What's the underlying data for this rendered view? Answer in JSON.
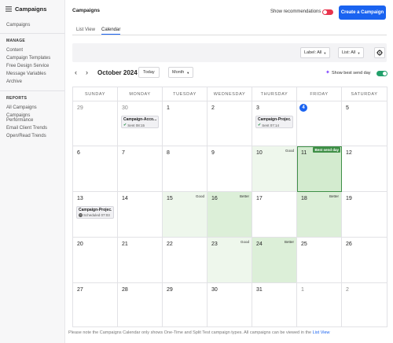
{
  "sidebar": {
    "title": "Campaigns",
    "top_link": "Campaigns",
    "sections": [
      {
        "heading": "MANAGE",
        "items": [
          "Content",
          "Campaign Templates",
          "Free Design Service",
          "Message Variables",
          "Archive"
        ]
      },
      {
        "heading": "REPORTS",
        "items": [
          "All Campaigns",
          "Campaigns Performance",
          "Email Client Trends",
          "Open/Read Trends"
        ]
      }
    ]
  },
  "header": {
    "title": "Campaigns",
    "show_recommendations": "Show recommendations",
    "create_button": "Create a Campaign"
  },
  "tabs": [
    "List View",
    "Calendar"
  ],
  "filters": {
    "label": "Label: All",
    "list": "List: All"
  },
  "nav": {
    "month_title": "October 2024",
    "today": "Today",
    "view": "Month",
    "best_send_day": "Show best send day"
  },
  "weekdays": [
    "SUNDAY",
    "MONDAY",
    "TUESDAY",
    "WEDNESDAY",
    "THURSDAY",
    "FRIDAY",
    "SATURDAY"
  ],
  "weeks": [
    [
      "29",
      "30",
      "1",
      "2",
      "3",
      "4",
      "5"
    ],
    [
      "6",
      "7",
      "8",
      "9",
      "10",
      "11",
      "12"
    ],
    [
      "13",
      "14",
      "15",
      "16",
      "17",
      "18",
      "19"
    ],
    [
      "20",
      "21",
      "22",
      "23",
      "24",
      "25",
      "26"
    ],
    [
      "27",
      "28",
      "29",
      "30",
      "31",
      "1",
      "2"
    ]
  ],
  "tags": {
    "good": "Good",
    "better": "Better",
    "best": "Best send day"
  },
  "events": [
    {
      "title": "Campaign-Acco...",
      "status": "Sent 08:15"
    },
    {
      "title": "Campaign-Projec...",
      "status": "Sent 07:14"
    },
    {
      "title": "Campaign-Projec...",
      "status": "Scheduled 07:03"
    }
  ],
  "footnote": {
    "text": "Please note the Campaigns Calendar only shows One-Time and Split Test campaign types. All campaigns can be viewed in the ",
    "link": "List View"
  },
  "colors": {
    "primary": "#1a63f0",
    "good": "#eef7ec",
    "better": "#dcefd8",
    "best": "#3f8f47",
    "toggle_off": "#e8344d",
    "toggle_on": "#22a06b"
  }
}
